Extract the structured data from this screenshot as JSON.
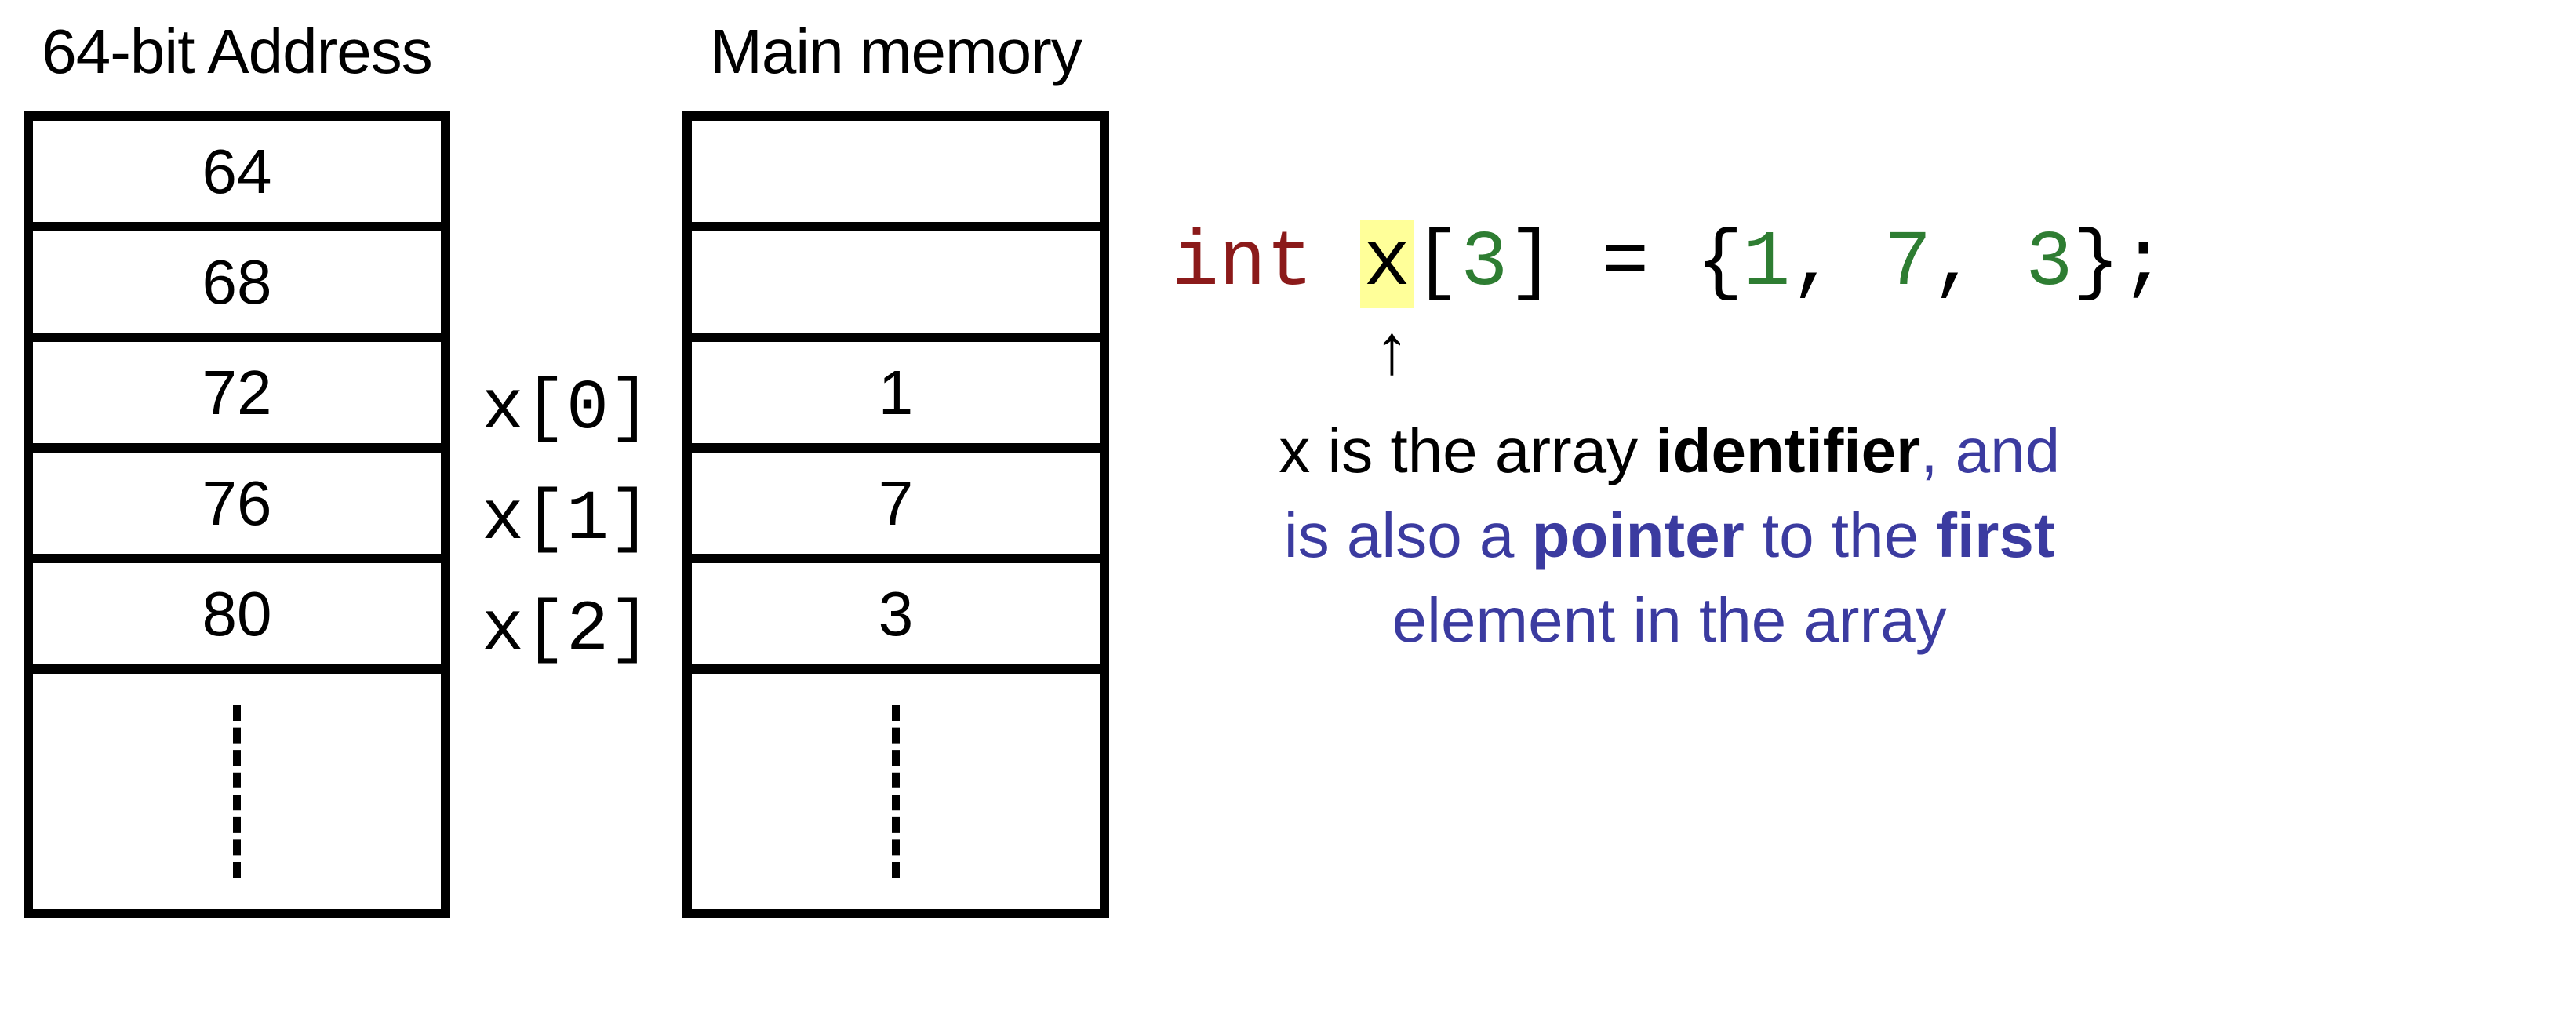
{
  "addressColumn": {
    "title": "64-bit Address",
    "rows": [
      "64",
      "68",
      "72",
      "76",
      "80"
    ]
  },
  "memoryColumn": {
    "title": "Main memory",
    "rows": [
      "",
      "",
      "1",
      "7",
      "3"
    ]
  },
  "indexLabels": [
    "x[0]",
    "x[1]",
    "x[2]"
  ],
  "code": {
    "type_kw": "int",
    "var": "x",
    "size": "3",
    "initializer_values": [
      "1",
      "7",
      "3"
    ]
  },
  "caption": {
    "part1": "x is the array ",
    "bold1": "identifier",
    "part2": ", and",
    "line2a": "is also a ",
    "bold2": "pointer",
    "line2b": " to the ",
    "bold3": "first",
    "line3": "element in the array"
  },
  "arrow_glyph": "↑"
}
